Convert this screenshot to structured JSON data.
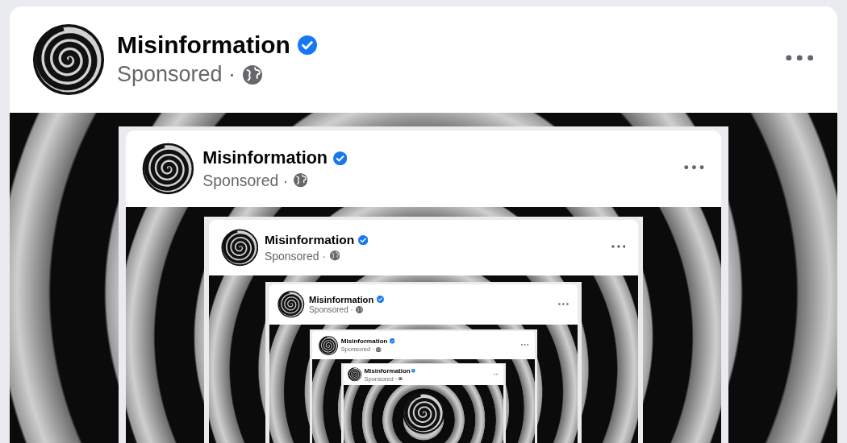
{
  "post": {
    "name": "Misinformation",
    "verified": true,
    "subtitle": "Sponsored ·",
    "nested_post": {
      "name": "Misinformation",
      "verified": true,
      "subtitle": "Sponsored ·",
      "nested_post": {
        "name": "Misinformation",
        "verified": true,
        "subtitle": "Sponsored ·",
        "nested_post": {
          "name": "Misinformation",
          "verified": true,
          "subtitle": "Sponsored ·",
          "nested_post": {
            "name": "Misinformation",
            "verified": true,
            "subtitle": "Sponsored ·",
            "nested_post": {
              "name": "Misinformation",
              "verified": true,
              "subtitle": "Sponsored ·"
            }
          }
        }
      }
    }
  }
}
